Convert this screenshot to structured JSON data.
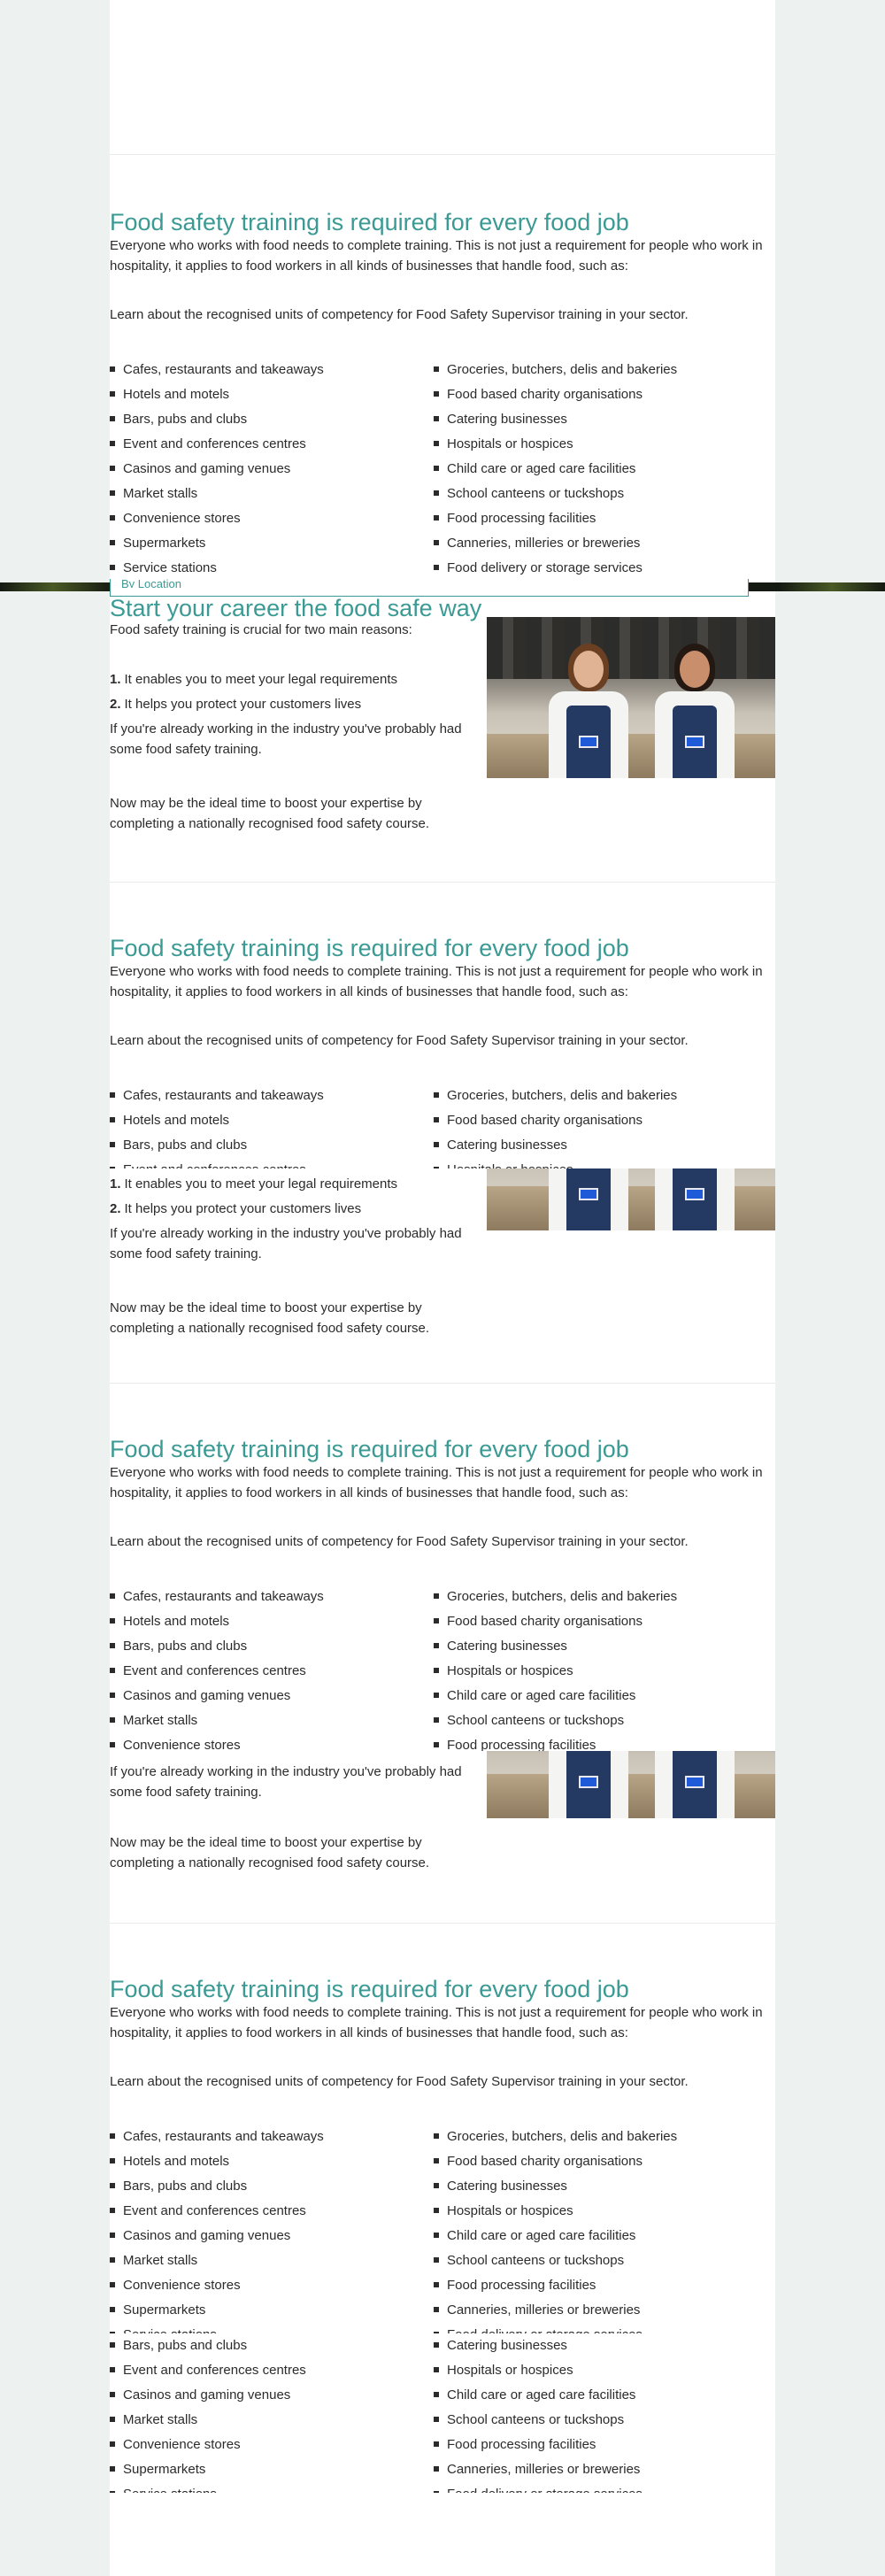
{
  "location_label": "By Location",
  "hero": {
    "title": "Start your career the food safe way",
    "intro": "Food safety training is crucial for two main reasons:",
    "reasons": [
      {
        "num": "1.",
        "text": "It enables you to meet your legal requirements"
      },
      {
        "num": "2.",
        "text": "It helps you protect your customers lives"
      }
    ],
    "already": "If you're already working in the industry you've probably had some food safety training.",
    "boost": "Now may be the ideal time to boost your expertise by completing a nationally recognised food safety course."
  },
  "required": {
    "title": "Food safety training is required for every food job",
    "body": "Everyone who works with food needs to complete training. This is not just a requirement for people who work in hospitality, it applies to food workers in all kinds of businesses that handle food, such as:",
    "learn": "Learn about the recognised units of competency for Food Safety Supervisor training in your sector.",
    "left_items": [
      "Cafes, restaurants and takeaways",
      "Hotels and motels",
      "Bars, pubs and clubs",
      "Event and conferences centres",
      "Casinos and gaming venues",
      "Market stalls",
      "Convenience stores",
      "Supermarkets",
      "Service stations"
    ],
    "right_items": [
      "Groceries, butchers, delis and bakeries",
      "Food based charity organisations",
      "Catering businesses",
      "Hospitals or hospices",
      "Child care or aged care facilities",
      "School canteens or tuckshops",
      "Food processing facilities",
      "Canneries, milleries or breweries",
      "Food delivery or storage services"
    ]
  },
  "colors": {
    "accent": "#3b9a94",
    "text": "#2b2b2b",
    "page_bg": "#edf2f0",
    "column_bg": "#ffffff"
  },
  "icons": {
    "bullet": "square-bullet-icon"
  }
}
